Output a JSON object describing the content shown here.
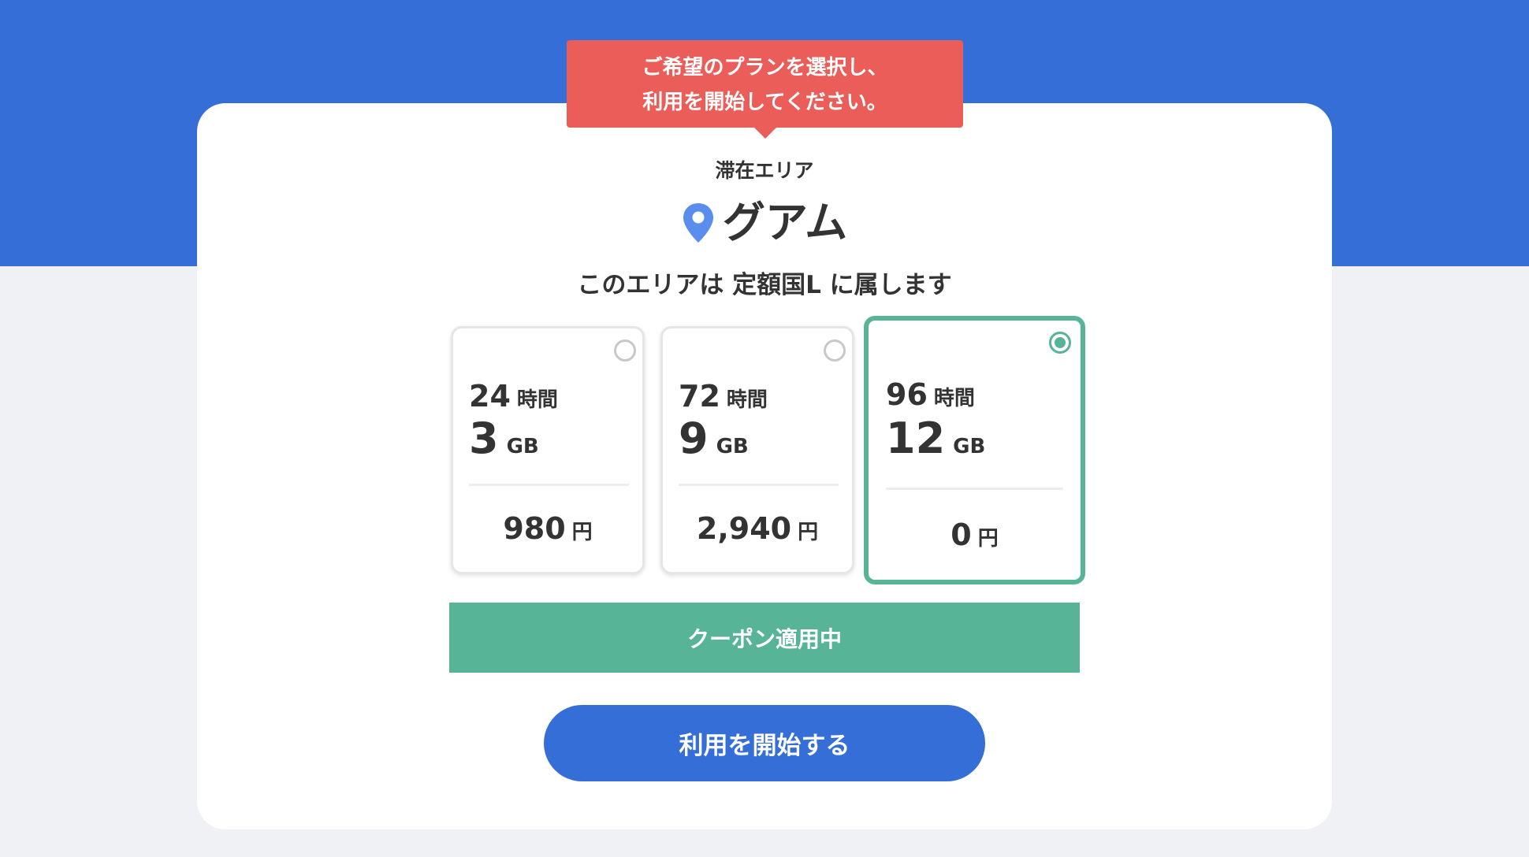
{
  "tooltip": {
    "line1": "ご希望のプランを選択し、",
    "line2": "利用を開始してください。"
  },
  "area": {
    "label": "滞在エリア",
    "name": "グアム",
    "description": "このエリアは 定額国L に属します",
    "icon": "map-pin-icon"
  },
  "plans": [
    {
      "hours": "24",
      "hours_unit": "時間",
      "data": "3",
      "data_unit": "GB",
      "price": "980",
      "price_unit": "円",
      "selected": false
    },
    {
      "hours": "72",
      "hours_unit": "時間",
      "data": "9",
      "data_unit": "GB",
      "price": "2,940",
      "price_unit": "円",
      "selected": false
    },
    {
      "hours": "96",
      "hours_unit": "時間",
      "data": "12",
      "data_unit": "GB",
      "price": "0",
      "price_unit": "円",
      "selected": true
    }
  ],
  "coupon": {
    "label": "クーポン適用中"
  },
  "start_button": {
    "label": "利用を開始する"
  },
  "colors": {
    "brand_blue": "#356ed6",
    "tooltip_red": "#eb5d58",
    "selected_green": "#58b497",
    "pin_blue": "#5b8def"
  }
}
